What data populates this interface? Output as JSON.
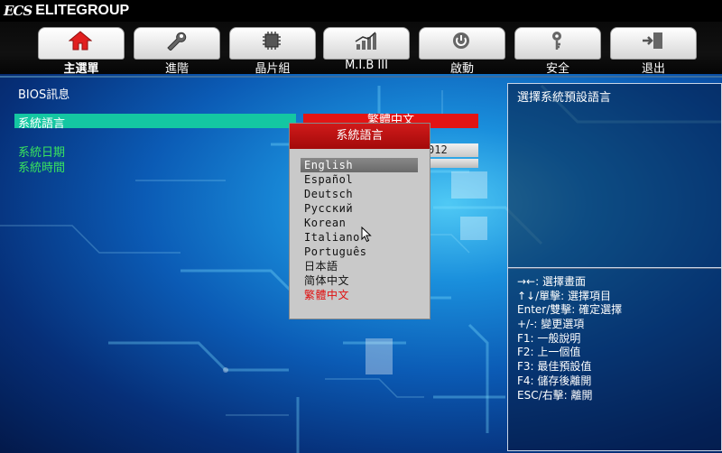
{
  "brand": {
    "logo_mark": "ECS",
    "name": "ELITEGROUP"
  },
  "tabs": [
    {
      "label": "主選單",
      "icon": "home-icon",
      "active": true
    },
    {
      "label": "進階",
      "icon": "wrench-icon",
      "active": false
    },
    {
      "label": "晶片組",
      "icon": "chip-icon",
      "active": false
    },
    {
      "label": "M.I.B III",
      "icon": "bar-graph-icon",
      "active": false
    },
    {
      "label": "啟動",
      "icon": "power-icon",
      "active": false
    },
    {
      "label": "安全",
      "icon": "key-icon",
      "active": false
    },
    {
      "label": "退出",
      "icon": "exit-icon",
      "active": false
    }
  ],
  "main": {
    "bios_info_label": "BIOS訊息",
    "language_label": "系統語言",
    "language_value": "繁體中文",
    "date_label": "系統日期",
    "date_value_visible": "012",
    "time_label": "系統時間"
  },
  "popup": {
    "title": "系統語言",
    "options": [
      "English",
      "Español",
      "Deutsch",
      "Русский",
      "Korean",
      "Italiano",
      "Português",
      "日本語",
      "简体中文",
      "繁體中文"
    ],
    "selected_index": 0,
    "current_index": 9
  },
  "help": {
    "title": "選擇系統預設語言",
    "keys": [
      "→←: 選擇畫面",
      "↑↓/單擊: 選擇項目",
      "Enter/雙擊: 確定選擇",
      "+/-: 變更選項",
      "F1: 一般說明",
      "F2: 上一個值",
      "F3: 最佳預設值",
      "F4: 儲存後離開",
      "ESC/右擊: 離開"
    ]
  },
  "colors": {
    "accent_red": "#e21414",
    "highlight_teal": "#14c7a2",
    "label_green": "#39e45e",
    "panel_border": "#c8d4e6"
  }
}
